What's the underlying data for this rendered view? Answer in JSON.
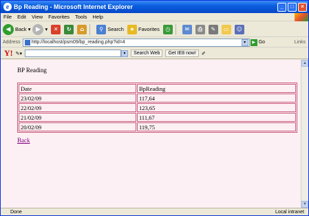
{
  "window": {
    "title": "Bp Reading - Microsoft Internet Explorer"
  },
  "menu": {
    "items": [
      "File",
      "Edit",
      "View",
      "Favorites",
      "Tools",
      "Help"
    ]
  },
  "toolbar": {
    "back": "Back",
    "search": "Search",
    "favorites": "Favorites"
  },
  "address": {
    "label": "Address",
    "url": "http://localhost/psm09/bp_reading.php?id=4",
    "go": "Go",
    "links": "Links"
  },
  "yahoo": {
    "logo": "Y!",
    "search_web": "Search Web",
    "get_ie8": "Get IE8 now!"
  },
  "page": {
    "heading": "BP Reading",
    "table": {
      "headers": [
        "Date",
        "BpReading"
      ],
      "rows": [
        [
          "23/02/09",
          "117,64"
        ],
        [
          "22/02/09",
          "123,65"
        ],
        [
          "21/02/09",
          "111,67"
        ],
        [
          "20/02/09",
          "119,75"
        ]
      ]
    },
    "back_link": "Back"
  },
  "status": {
    "text": "Done",
    "zone": "Local intranet"
  }
}
